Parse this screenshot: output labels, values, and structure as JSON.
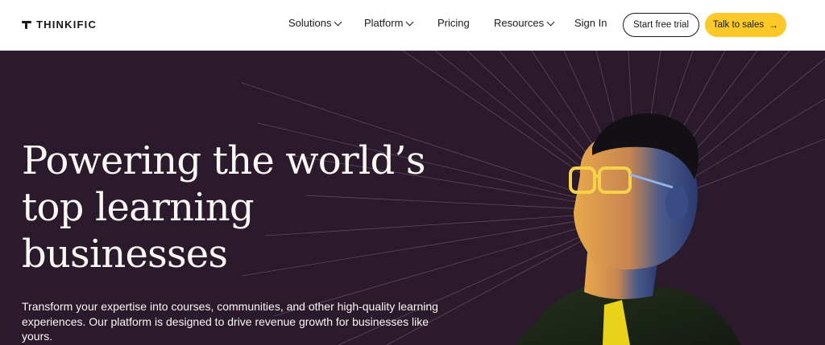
{
  "nav": {
    "brand": "THINKIFIC",
    "menu": [
      {
        "label": "Solutions",
        "has_dropdown": true
      },
      {
        "label": "Platform",
        "has_dropdown": true
      },
      {
        "label": "Pricing",
        "has_dropdown": false
      },
      {
        "label": "Resources",
        "has_dropdown": true
      },
      {
        "label": "Sign In",
        "has_dropdown": false
      }
    ],
    "start_trial": "Start free trial",
    "talk_sales": "Talk to sales",
    "talk_sales_icon": "arrow-right-icon"
  },
  "hero": {
    "headline_lines": [
      "Powering the world’s",
      "top learning",
      "businesses"
    ],
    "subtitle": "Transform your expertise into courses, communities, and other high-quality learning experiences. Our platform is designed to drive revenue growth for businesses like yours."
  },
  "colors": {
    "hero_bg": "#2a1a2c",
    "accent_yellow": "#fcc928",
    "text_light": "#fbf8f3",
    "text_dark": "#1a1a1a"
  }
}
